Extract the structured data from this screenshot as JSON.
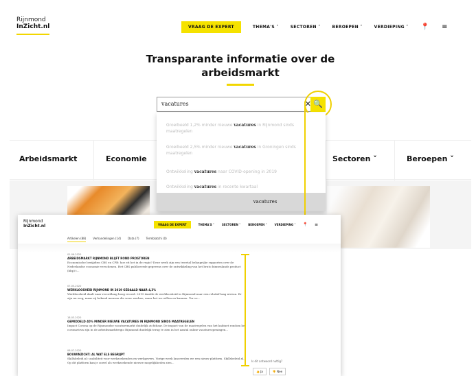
{
  "header": {
    "logo_line1": "Rijnmond",
    "logo_line2": "InZicht.nl",
    "nav": {
      "expert": "VRAAG DE EXPERT",
      "items": [
        "THEMA'S ˅",
        "SECTOREN ˅",
        "BEROEPEN ˅",
        "VERDIEPING ˅"
      ],
      "location_icon": "location-pin-icon",
      "menu_icon": "hamburger-menu-icon"
    }
  },
  "hero_title_line1": "Transparante informatie over de",
  "hero_title_line2": "arbeidsmarkt",
  "search": {
    "value": "vacatures",
    "clear_icon": "close-icon",
    "submit_icon": "search-icon"
  },
  "suggestions": [
    {
      "pre": "Groeibeeld 1,2% minder nieuwe ",
      "match": "vacatures",
      "post": " in Rijnmond sinds maatregelen"
    },
    {
      "pre": "Groeibeeld 2,5% minder nieuwe ",
      "match": "vacatures",
      "post": " in Groningen sinds maatregelen"
    },
    {
      "pre": "Ontwikkeling ",
      "match": "vacatures",
      "post": " naar COVID-opening in 2019"
    },
    {
      "pre": "Ontwikkeling ",
      "match": "vacatures",
      "post": " in recente kwartaal"
    },
    {
      "pre": "",
      "match": "vacatures",
      "post": ""
    }
  ],
  "categories": [
    "Arbeidsmarkt",
    "Economie",
    "Sectoren ˅",
    "Beroepen ˅"
  ],
  "front": {
    "logo_line1": "Rijnmond",
    "logo_line2": "InZicht.nl",
    "nav": {
      "expert": "VRAAG DE EXPERT",
      "items": [
        "THEMA'S ˅",
        "SECTOREN ˅",
        "BEROEPEN ˅",
        "VERDIEPING ˅"
      ]
    },
    "tabs": [
      "Artikelen (88)",
      "Verhandelingen (14)",
      "Data (7)",
      "Termblatchi (0)"
    ],
    "results": [
      {
        "date": "01-06-2020",
        "title": "ARBEIDSMARKT RIJNMOND BLIJFT ROND PROSTOREN",
        "body": "Economische berijjdten CBS en CPB: hoe eit het in de regio? Deze week zijn een tweetal belangrijke rapporten over de Nederlandse economie verschenen. Het CBS publiceerde gegevens over de ontwikkeling van het bruto binnenlands product (bbp) t..."
      },
      {
        "date": "07-05-2020",
        "title": "WERKLOOSHEID RIJNMOND IN 2019 GEDAALD NAAR 4,3%",
        "body": "Werkloosheid daalt naar recordlaag hoog record. 2019 daalde de werkloosheid in Rijnmond naar een relatief laag niveau. Er zijn nu weg; maar zij bekend mensen die weer werken, maar het we willen en kunnen. Ter ve..."
      },
      {
        "date": "18-03-2020",
        "title": "GEMIDDELD 40% MINDER NIEUWE VACATURES IN RIJNMOND SINDS MAATREGELEN",
        "body": "Impact Corona op de Rijnmondse vacaturemarkt duidelijk zichtbaar. De impact van de maatregelen van het kabinet rondom het coronavirus zijn in de arbeidsmarktregio Rijnmond duidelijk terug te zien in het aantal online vacatureopeningen..."
      },
      {
        "date": "06-07-2020",
        "title": "BOUWINZICHT: AL WAT ELS BEGRIJPT",
        "body": "Skillsbeleid.nl: usabiliteit voor werkzoekenden en werkgevers. Vorige week lanceerden we een nieuw platform. Skillsbeleid.nl. Op dit platform kan je zowel als werkzoekende nieuwe mogelijkheden zien..."
      }
    ],
    "feedback_question": "Is dit antwoord nuttig?",
    "feedback_yes": "👍 Ja",
    "feedback_no": "👎 Nee"
  },
  "accent_color": "#f2d600"
}
